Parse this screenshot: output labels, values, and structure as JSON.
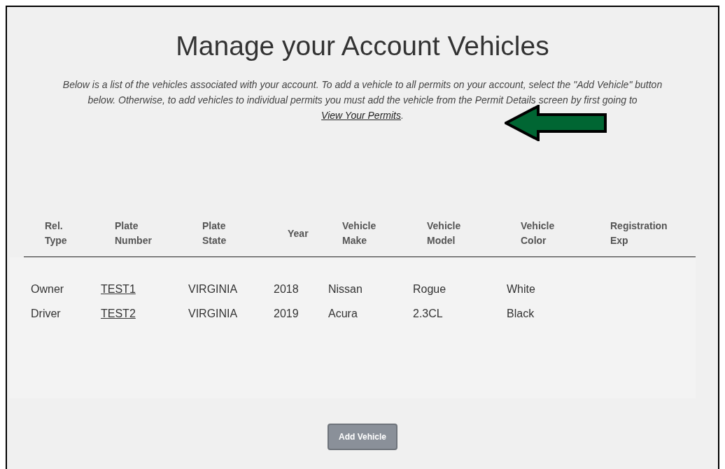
{
  "title": "Manage your Account Vehicles",
  "intro": {
    "text": "Below is a list of the vehicles associated with your account. To add a vehicle to all permits on your account, select the \"Add Vehicle\" button below. Otherwise, to add vehicles to individual permits you must add the vehicle from the Permit Details screen by first going to ",
    "link": "View Your Permits",
    "after": "."
  },
  "table": {
    "columns": [
      "Rel. Type",
      "Plate Number",
      "Plate State",
      "Year",
      "Vehicle Make",
      "Vehicle Model",
      "Vehicle Color",
      "Registration Exp"
    ],
    "rows": [
      [
        "Owner",
        "TEST1",
        "VIRGINIA",
        "2018",
        "Nissan",
        "Rogue",
        "White"
      ],
      [
        "Driver",
        "TEST2",
        "VIRGINIA",
        "2019",
        "Acura",
        "2.3CL",
        "Black"
      ]
    ]
  },
  "button": "Add Vehicle"
}
